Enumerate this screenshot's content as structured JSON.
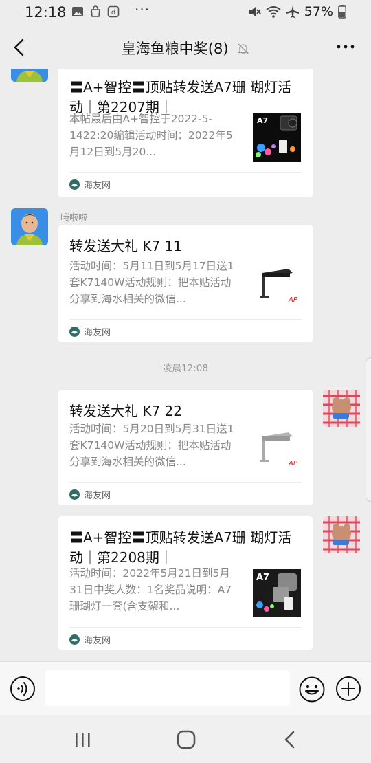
{
  "status_bar": {
    "time": "12:18",
    "more": "···",
    "battery_percent": "57%"
  },
  "header": {
    "title": "皇海鱼粮中奖(8)"
  },
  "messages": [
    {
      "side": "left",
      "card": {
        "title": "〓A+智控〓顶贴转发送A7珊 瑚灯活动｜第2207期｜",
        "desc": "本帖最后由A+智控于2022-5-1422:20编辑活动时间：2022年5月12日到5月20...",
        "source": "海友网",
        "thumb_label": "A7"
      }
    },
    {
      "side": "left",
      "sender": "哦啦啦",
      "card": {
        "title": "转发送大礼 K7 11",
        "desc": "活动时间：5月11日到5月17日送1套K7140W活动规则：把本贴活动分享到海水相关的微信...",
        "source": "海友网",
        "thumb_label": "AP"
      }
    },
    {
      "type": "time",
      "text": "凌晨12:08"
    },
    {
      "side": "right",
      "card": {
        "title": "转发送大礼 K7 22",
        "desc": "活动时间：5月20日到5月31日送1套K7140W活动规则：把本贴活动分享到海水相关的微信...",
        "source": "海友网",
        "thumb_label": "AP"
      }
    },
    {
      "side": "right",
      "card": {
        "title": "〓A+智控〓顶贴转发送A7珊 瑚灯活动｜第2208期｜",
        "desc": "活动时间：2022年5月21日到5月31日中奖人数：1名奖品说明：A7珊瑚灯一套(含支架和...",
        "source": "海友网",
        "thumb_label": "A7"
      }
    }
  ],
  "input_bar": {
    "placeholder": ""
  },
  "colors": {
    "background": "#ededed",
    "card": "#ffffff",
    "wechat_green": "#07c160",
    "muted_text": "#888888"
  }
}
